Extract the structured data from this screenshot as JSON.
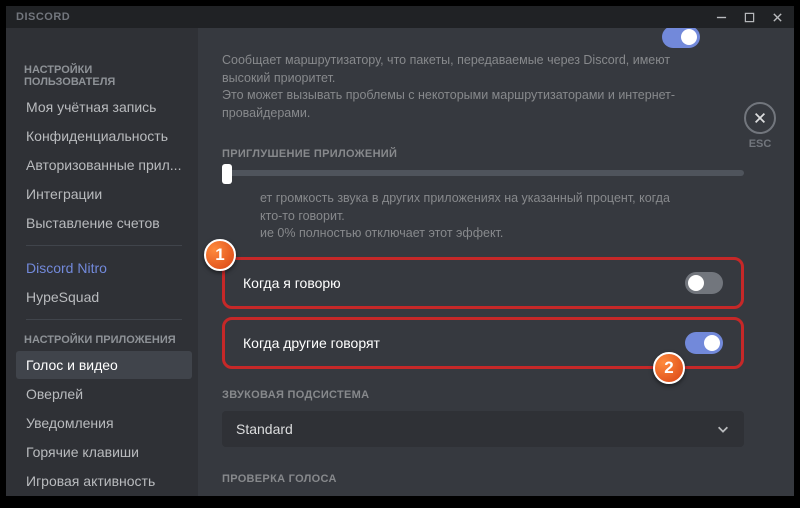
{
  "titlebar": {
    "brand": "DISCORD"
  },
  "esc": {
    "label": "ESC"
  },
  "sidebar": {
    "user_header": "НАСТРОЙКИ ПОЛЬЗОВАТЕЛЯ",
    "items_user": [
      "Моя учётная запись",
      "Конфиденциальность",
      "Авторизованные прил...",
      "Интеграции",
      "Выставление счетов"
    ],
    "nitro": "Discord Nitro",
    "hypesquad": "HypeSquad",
    "app_header": "НАСТРОЙКИ ПРИЛОЖЕНИЯ",
    "items_app": [
      "Голос и видео",
      "Оверлей",
      "Уведомления",
      "Горячие клавиши",
      "Игровая активность"
    ],
    "active_index": 0
  },
  "content": {
    "qos_desc_line1": "Сообщает маршрутизатору, что пакеты, передаваемые через Discord, имеют высокий приоритет.",
    "qos_desc_line2": "Это может вызывать проблемы с некоторыми маршрутизаторами и интернет-провайдерами.",
    "attenuation_header": "ПРИГЛУШЕНИЕ ПРИЛОЖЕНИЙ",
    "attenuation_desc_line1": "ет громкость звука в других приложениях на указанный процент, когда кто-то говорит.",
    "attenuation_desc_line2": "ие 0% полностью отключает этот эффект.",
    "row1_label": "Когда я говорю",
    "row2_label": "Когда другие говорят",
    "audio_subsystem_header": "ЗВУКОВАЯ ПОДСИСТЕМА",
    "audio_subsystem_value": "Standard",
    "voice_test_header": "ПРОВЕРКА ГОЛОСА"
  },
  "badges": {
    "one": "1",
    "two": "2"
  },
  "toggles": {
    "qos": true,
    "when_i_speak": false,
    "when_others_speak": true
  }
}
